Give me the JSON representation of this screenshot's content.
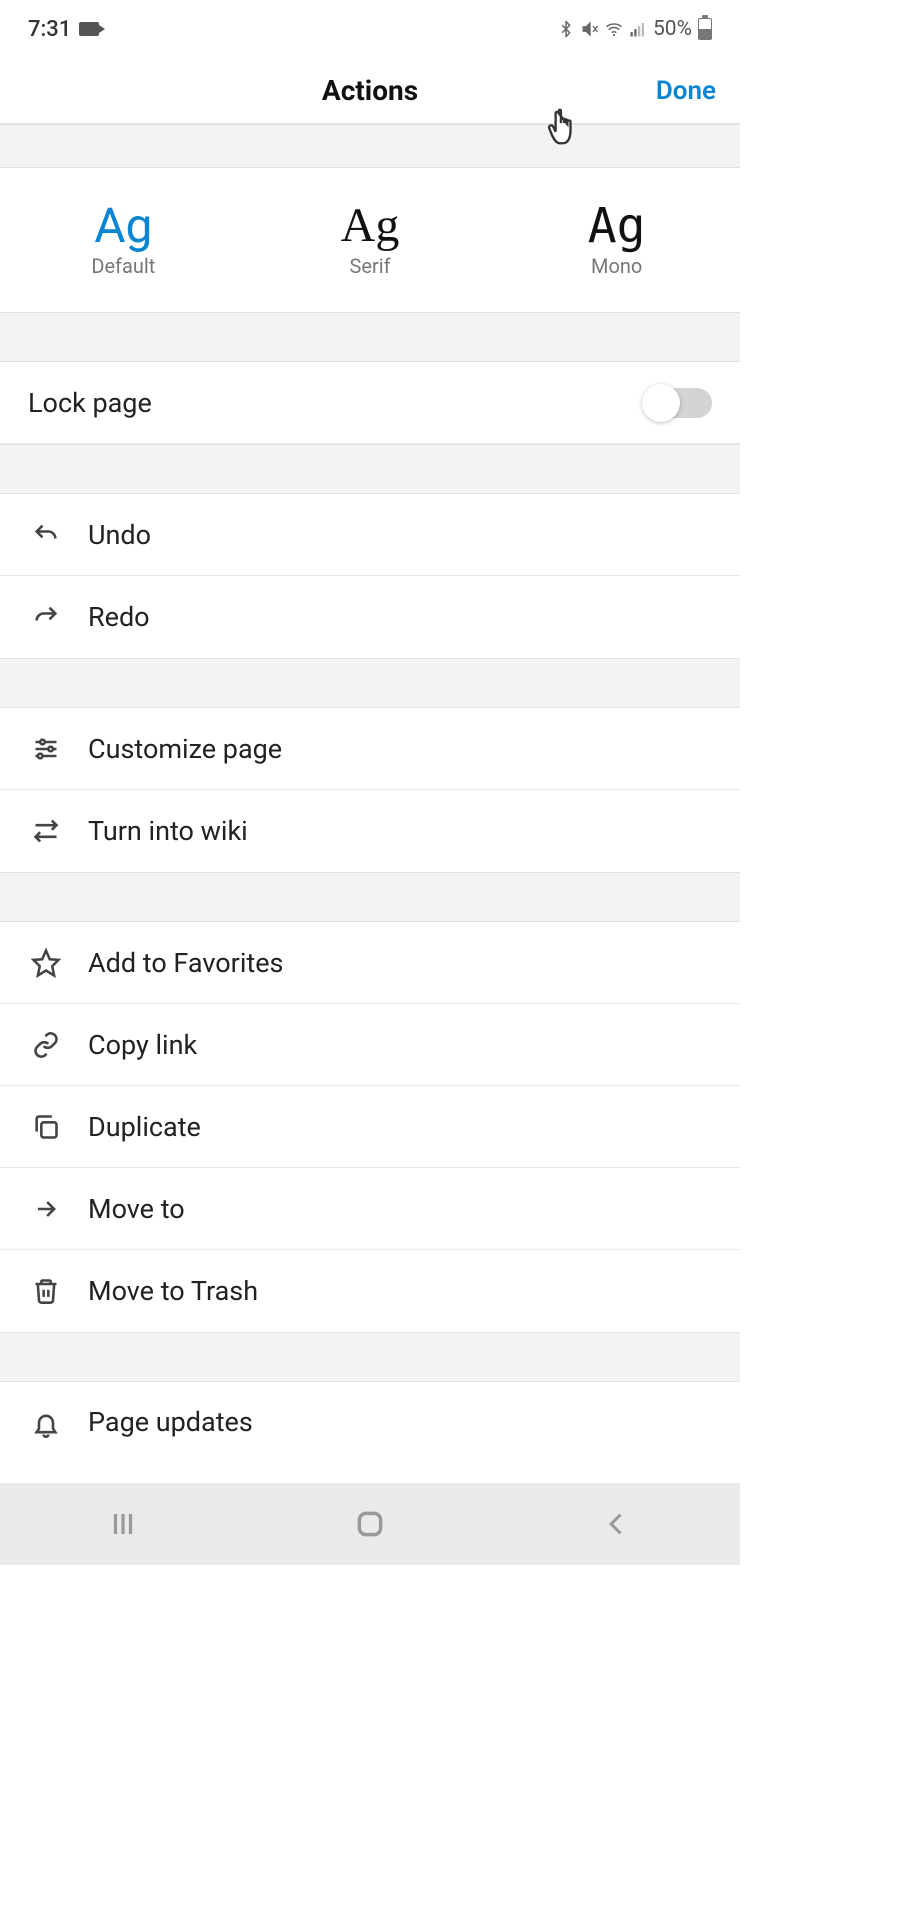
{
  "status": {
    "time": "7:31",
    "battery_pct": "50%"
  },
  "header": {
    "title": "Actions",
    "done": "Done"
  },
  "fonts": {
    "sample": "Ag",
    "option0": "Default",
    "option1": "Serif",
    "option2": "Mono"
  },
  "lock": {
    "label": "Lock page",
    "enabled": false
  },
  "actions": {
    "undo": "Undo",
    "redo": "Redo",
    "customize": "Customize page",
    "wiki": "Turn into wiki",
    "favorites": "Add to Favorites",
    "copylink": "Copy link",
    "duplicate": "Duplicate",
    "moveto": "Move to",
    "trash": "Move to Trash",
    "updates": "Page updates"
  }
}
